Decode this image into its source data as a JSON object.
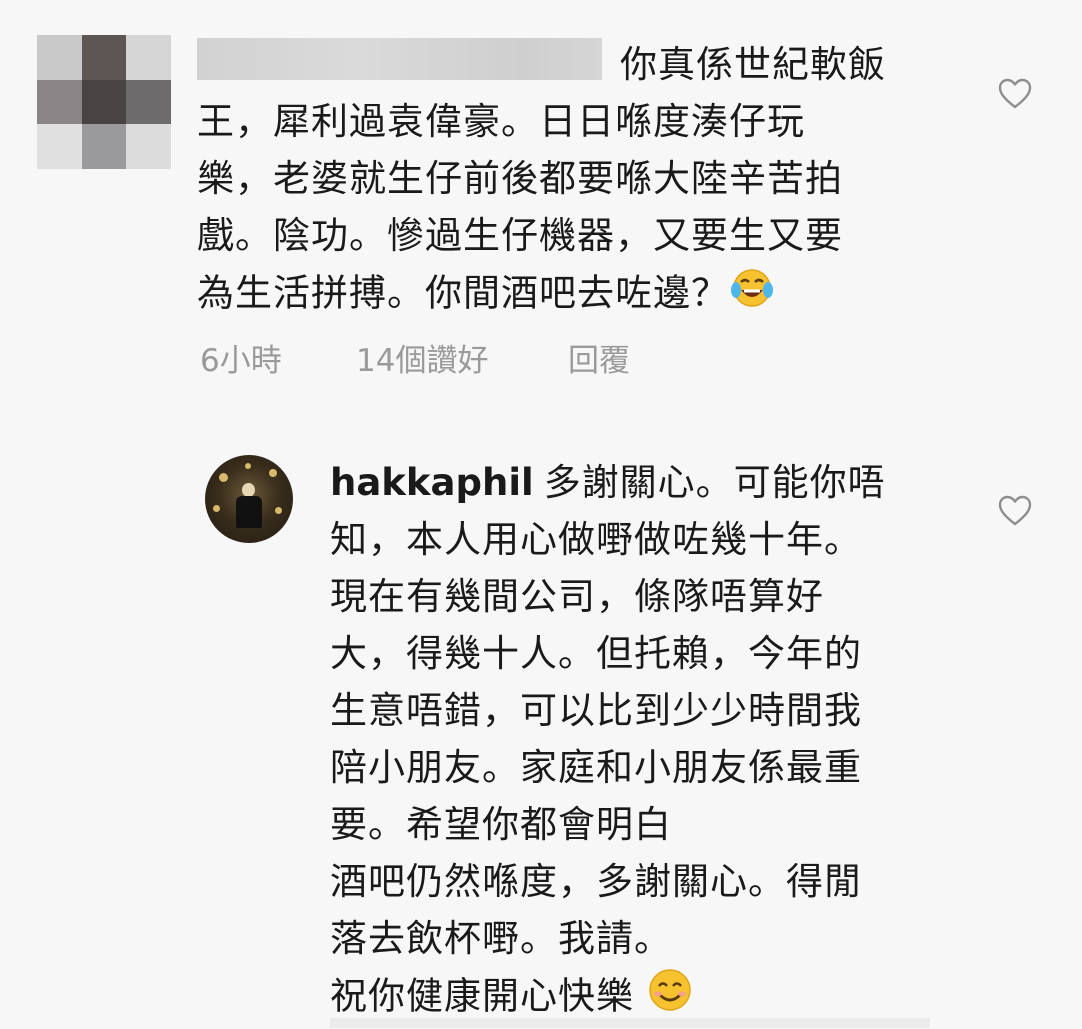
{
  "comment1": {
    "lines": [
      "你真係世紀軟飯",
      "王，犀利過袁偉豪。日日喺度湊仔玩",
      "樂，老婆就生仔前後都要喺大陸辛苦拍",
      "戲。陰功。慘過生仔機器，又要生又要",
      "為生活拼搏。你間酒吧去咗邊？"
    ],
    "emoji_icon": "face-with-tears-of-joy",
    "time": "6小時",
    "likes": "14個讚好",
    "reply": "回覆"
  },
  "comment2": {
    "username": "hakkaphil",
    "first_line": "多謝關心。可能你唔",
    "lines": [
      "知，本人用心做嘢做咗幾十年。",
      "現在有幾間公司，條隊唔算好",
      "大，得幾十人。但托賴，今年的",
      "生意唔錯，可以比到少少時間我",
      "陪小朋友。家庭和小朋友係最重",
      "要。希望你都會明白",
      "酒吧仍然喺度，多謝關心。得閒",
      "落去飲杯嘢。我請。",
      "祝你健康開心快樂"
    ],
    "emoji_icon": "smiling-face-with-smiling-eyes"
  },
  "colors": {
    "background": "#f7f7f7",
    "text": "#1a1a1a",
    "meta_text": "#9a9a9a",
    "heart_stroke": "#8e8e8e"
  }
}
